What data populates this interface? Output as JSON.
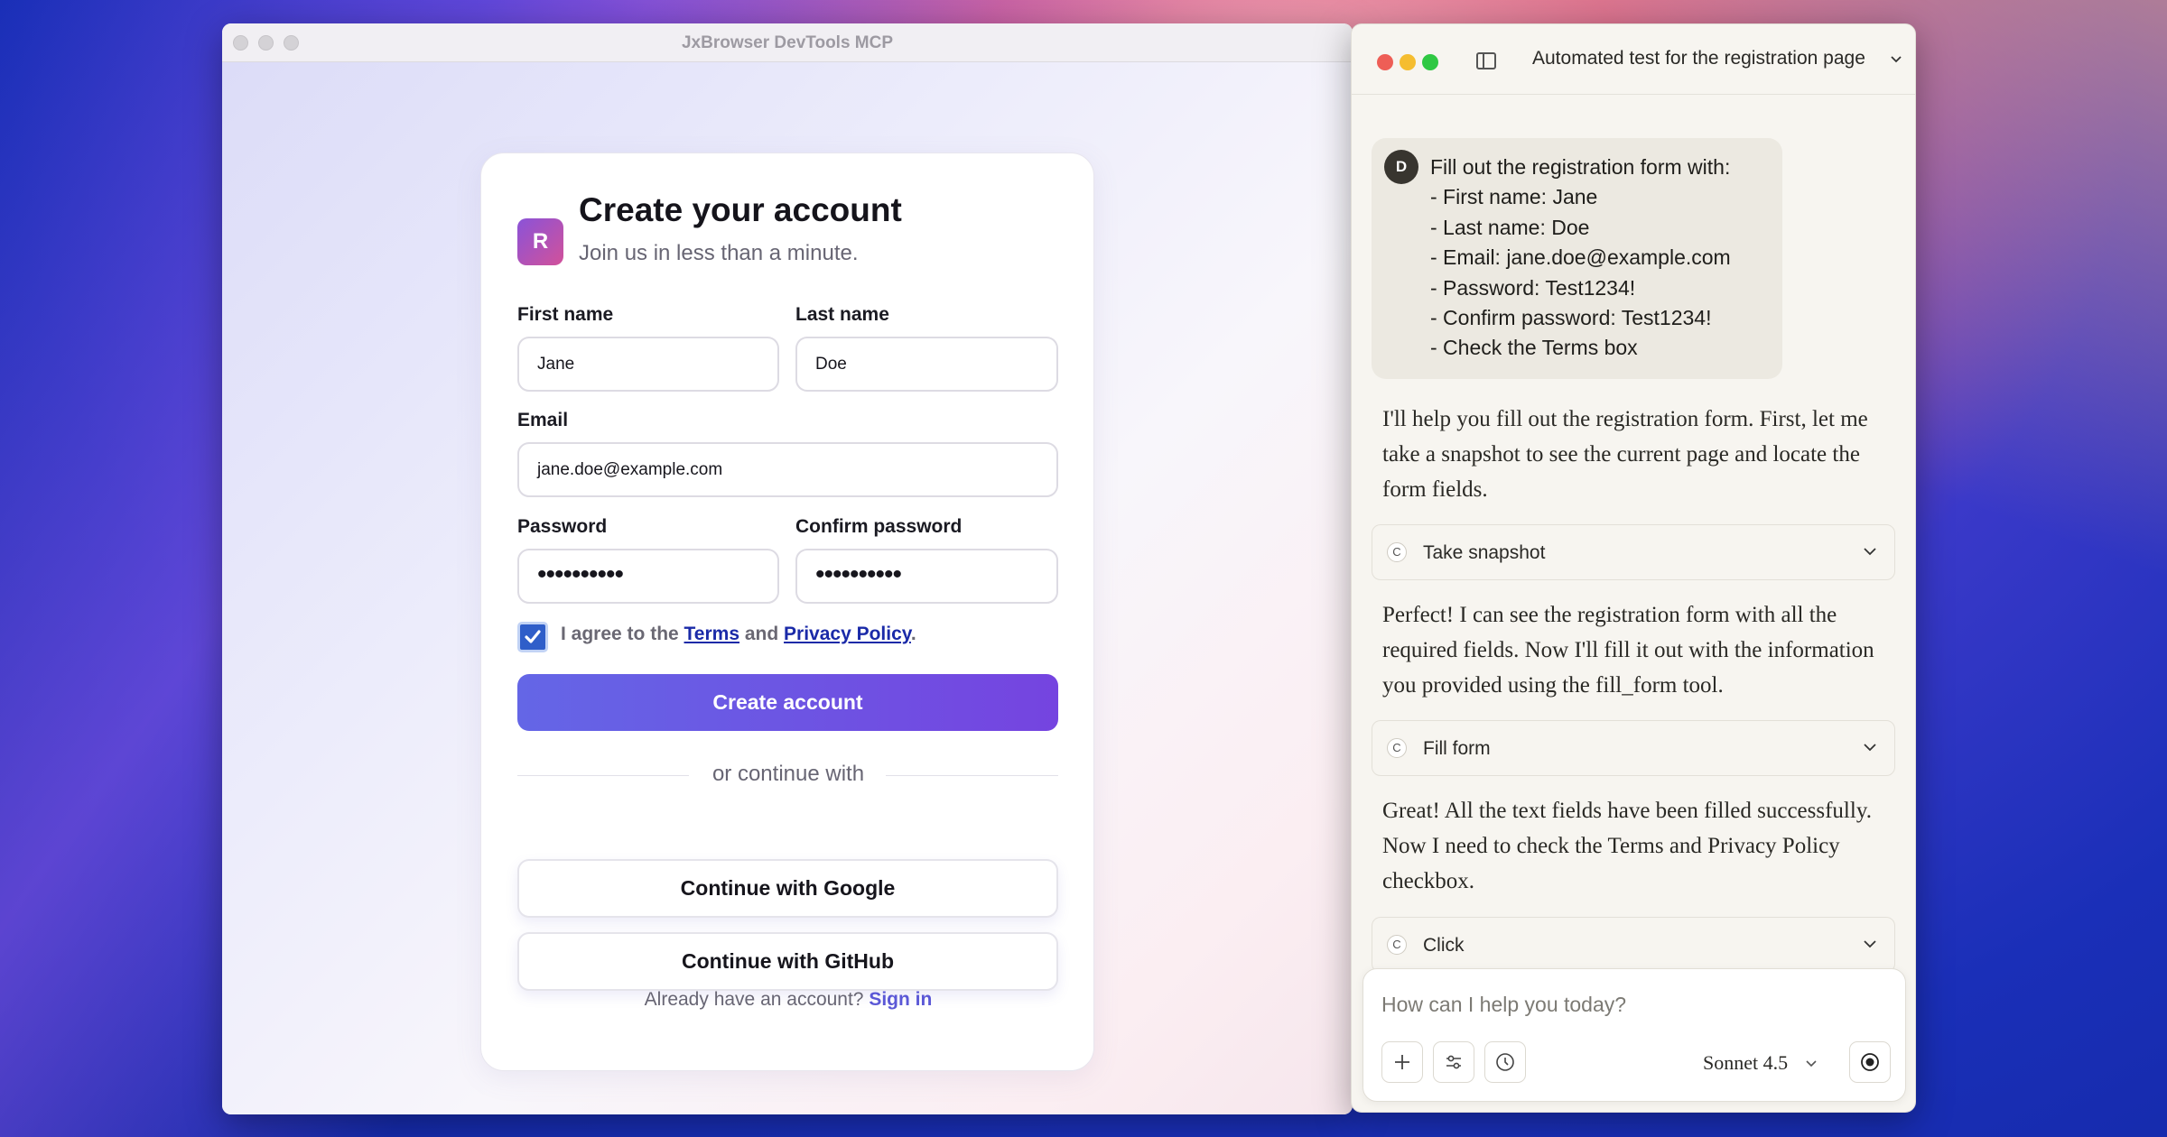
{
  "browser": {
    "title": "JxBrowser DevTools MCP"
  },
  "form": {
    "logo_letter": "R",
    "title": "Create your account",
    "subtitle": "Join us in less than a minute.",
    "first_name_label": "First name",
    "first_name_value": "Jane",
    "last_name_label": "Last name",
    "last_name_value": "Doe",
    "email_label": "Email",
    "email_value": "jane.doe@example.com",
    "password_label": "Password",
    "password_dots": "••••••••••",
    "confirm_label": "Confirm password",
    "confirm_dots": "••••••••••",
    "agree_prefix": "I agree to the ",
    "terms_link": "Terms",
    "agree_and": " and ",
    "privacy_link": "Privacy Policy",
    "agree_suffix": ".",
    "terms_checked": true,
    "create_button": "Create account",
    "divider_text": "or continue with",
    "google_button": "Continue with Google",
    "github_button": "Continue with GitHub",
    "signin_prompt": "Already have an account?",
    "signin_link": "Sign in"
  },
  "chat": {
    "title": "Automated test for the registration page",
    "user_avatar": "D",
    "user_message_lines": [
      "Fill out the registration form with:",
      "- First name: Jane",
      "- Last name: Doe",
      "- Email: jane.doe@example.com",
      "- Password: Test1234!",
      "- Confirm password: Test1234!",
      "- Check the Terms box"
    ],
    "assistant_1": "I'll help you fill out the registration form. First, let me take a snapshot to see the current page and locate the form fields.",
    "tool_1": "Take snapshot",
    "assistant_2": "Perfect! I can see the registration form with all the required fields. Now I'll fill it out with the information you provided using the fill_form tool.",
    "tool_2": "Fill form",
    "assistant_3": "Great! All the text fields have been filled successfully. Now I need to check the Terms and Privacy Policy checkbox.",
    "tool_3": "Click",
    "tool_icon_letter": "C",
    "composer_placeholder": "How can I help you today?",
    "model": "Sonnet 4.5"
  },
  "colors": {
    "primary_button_start": "#6466e6",
    "primary_button_end": "#7544e0",
    "link": "#1a2aa8",
    "signin_link": "#5b58d6",
    "traffic_red": "#ee5e56",
    "traffic_yellow": "#f5bd30",
    "traffic_green": "#2fc843"
  }
}
